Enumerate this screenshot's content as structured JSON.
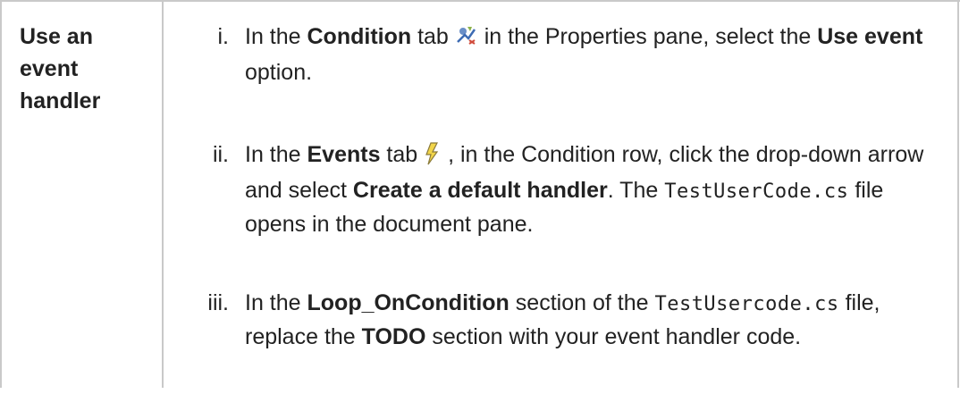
{
  "row": {
    "label_line1": "Use an",
    "label_line2": "event",
    "label_line3": "handler"
  },
  "steps": [
    {
      "num": "i.",
      "t1": "In the ",
      "b1": "Condition",
      "t2": " tab ",
      "icon": "condition-tab-icon",
      "t3": " in the Properties pane, select the ",
      "b2": "Use event",
      "t4": " option."
    },
    {
      "num": "ii.",
      "t1": "In the ",
      "b1": "Events",
      "t2": " tab ",
      "icon": "events-tab-icon",
      "t3": " , in the Condition row, click the drop-down arrow and select ",
      "b2": "Create a default handler",
      "t4": ". The ",
      "code": "TestUserCode.cs",
      "t5": " file opens in the document pane."
    },
    {
      "num": "iii.",
      "t1": "In the ",
      "b1": "Loop_OnCondition",
      "t2": " section of the ",
      "code": "TestUsercode.cs",
      "t3": " file, replace the ",
      "b2": "TODO",
      "t4": " section with your event handler code."
    }
  ]
}
